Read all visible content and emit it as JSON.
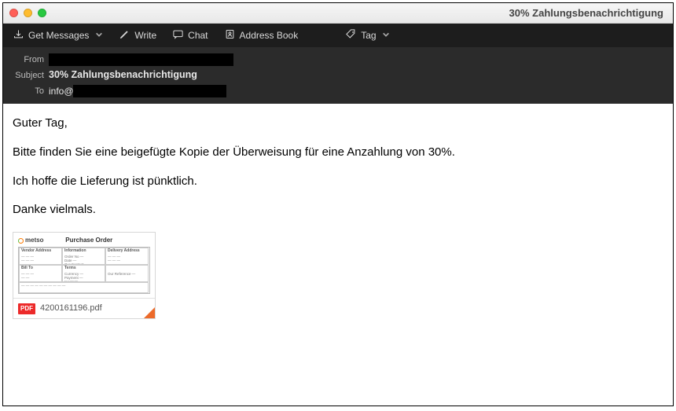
{
  "window": {
    "title": "30% Zahlungsbenachrichtigung"
  },
  "toolbar": {
    "get_messages": "Get Messages",
    "write": "Write",
    "chat": "Chat",
    "address_book": "Address Book",
    "tag": "Tag"
  },
  "headers": {
    "from_label": "From",
    "subject_label": "Subject",
    "to_label": "To",
    "subject_value": "30% Zahlungsbenachrichtigung",
    "to_visible_prefix": "info@"
  },
  "body": {
    "greeting": "Guter Tag,",
    "line1": "Bitte finden Sie eine beigefügte Kopie der Überweisung für eine Anzahlung von 30%.",
    "line2": "Ich hoffe die Lieferung ist pünktlich.",
    "signoff": "Danke vielmals."
  },
  "attachment": {
    "brand": "metso",
    "doc_title": "Purchase Order",
    "filename": "4200161196.pdf",
    "badge": "PDF"
  }
}
